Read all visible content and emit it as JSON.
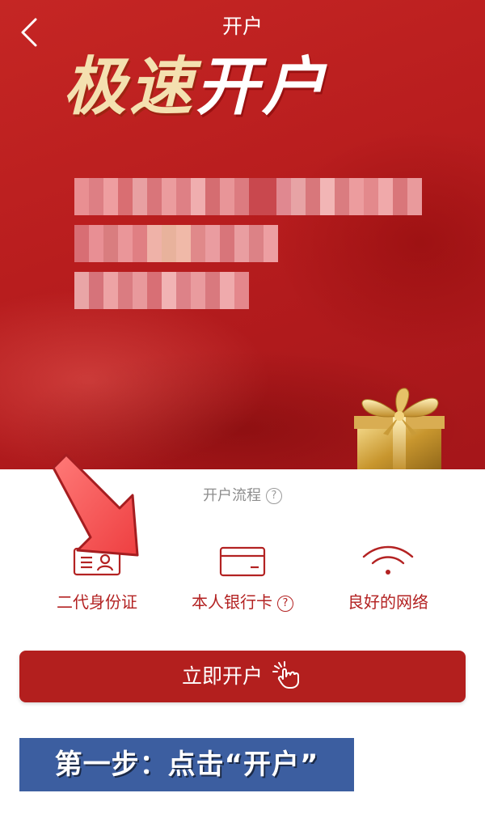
{
  "header": {
    "back_icon": "chevron-left-icon",
    "title": "开户"
  },
  "hero": {
    "title_gold": "极速",
    "title_white": "开户",
    "blurred_text": "pixelated-redacted",
    "decoration": "gold-gift-box"
  },
  "flow": {
    "label": "开户流程",
    "help_icon": "question-circle-icon"
  },
  "requirements": [
    {
      "icon": "id-card-icon",
      "label": "二代身份证"
    },
    {
      "icon": "bank-card-icon",
      "label": "本人银行卡",
      "help_icon": "question-circle-icon"
    },
    {
      "icon": "wifi-icon",
      "label": "良好的网络"
    }
  ],
  "open_button": {
    "label": "立即开户",
    "icon": "tap-hand-icon"
  },
  "annotation": {
    "step_text": "第一步：点击“开户”",
    "arrow": "red-arrow-pointing-to-id-card"
  },
  "colors": {
    "hero_red": "#b81d1e",
    "button_red": "#b31f1e",
    "gold": "#f4e0b0",
    "step_banner_blue": "#3c5ea0",
    "requirement_text": "#b32222"
  }
}
